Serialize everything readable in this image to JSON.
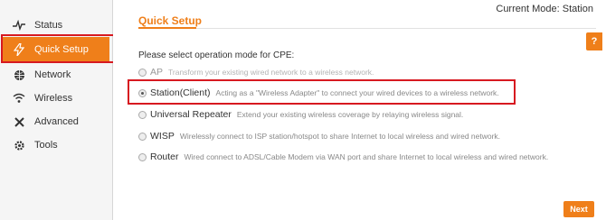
{
  "sidebar": {
    "items": [
      {
        "label": "Status",
        "icon": "pulse-icon"
      },
      {
        "label": "Quick Setup",
        "icon": "bolt-icon"
      },
      {
        "label": "Network",
        "icon": "globe-icon"
      },
      {
        "label": "Wireless",
        "icon": "wifi-icon"
      },
      {
        "label": "Advanced",
        "icon": "tools-icon"
      },
      {
        "label": "Tools",
        "icon": "gear-icon"
      }
    ],
    "active_index": 1
  },
  "header": {
    "current_mode": "Current Mode: Station",
    "title": "Quick Setup",
    "help": "?"
  },
  "main": {
    "prompt": "Please select operation mode for CPE:",
    "options": [
      {
        "name": "AP",
        "desc": "Transform your existing wired network to a wireless network.",
        "selected": false,
        "enabled": false
      },
      {
        "name": "Station(Client)",
        "desc": "Acting as a \"Wireless Adapter\" to connect your wired devices to a wireless network.",
        "selected": true,
        "enabled": true
      },
      {
        "name": "Universal Repeater",
        "desc": "Extend your existing wireless coverage by relaying wireless signal.",
        "selected": false,
        "enabled": true
      },
      {
        "name": "WISP",
        "desc": "Wirelessly connect to ISP station/hotspot to share Internet to local wireless and wired network.",
        "selected": false,
        "enabled": true
      },
      {
        "name": "Router",
        "desc": "Wired connect to ADSL/Cable Modem via WAN port and share Internet to local wireless and wired network.",
        "selected": false,
        "enabled": true
      }
    ],
    "next_label": "Next"
  },
  "colors": {
    "accent": "#ef7f1a",
    "highlight": "#d71920"
  }
}
